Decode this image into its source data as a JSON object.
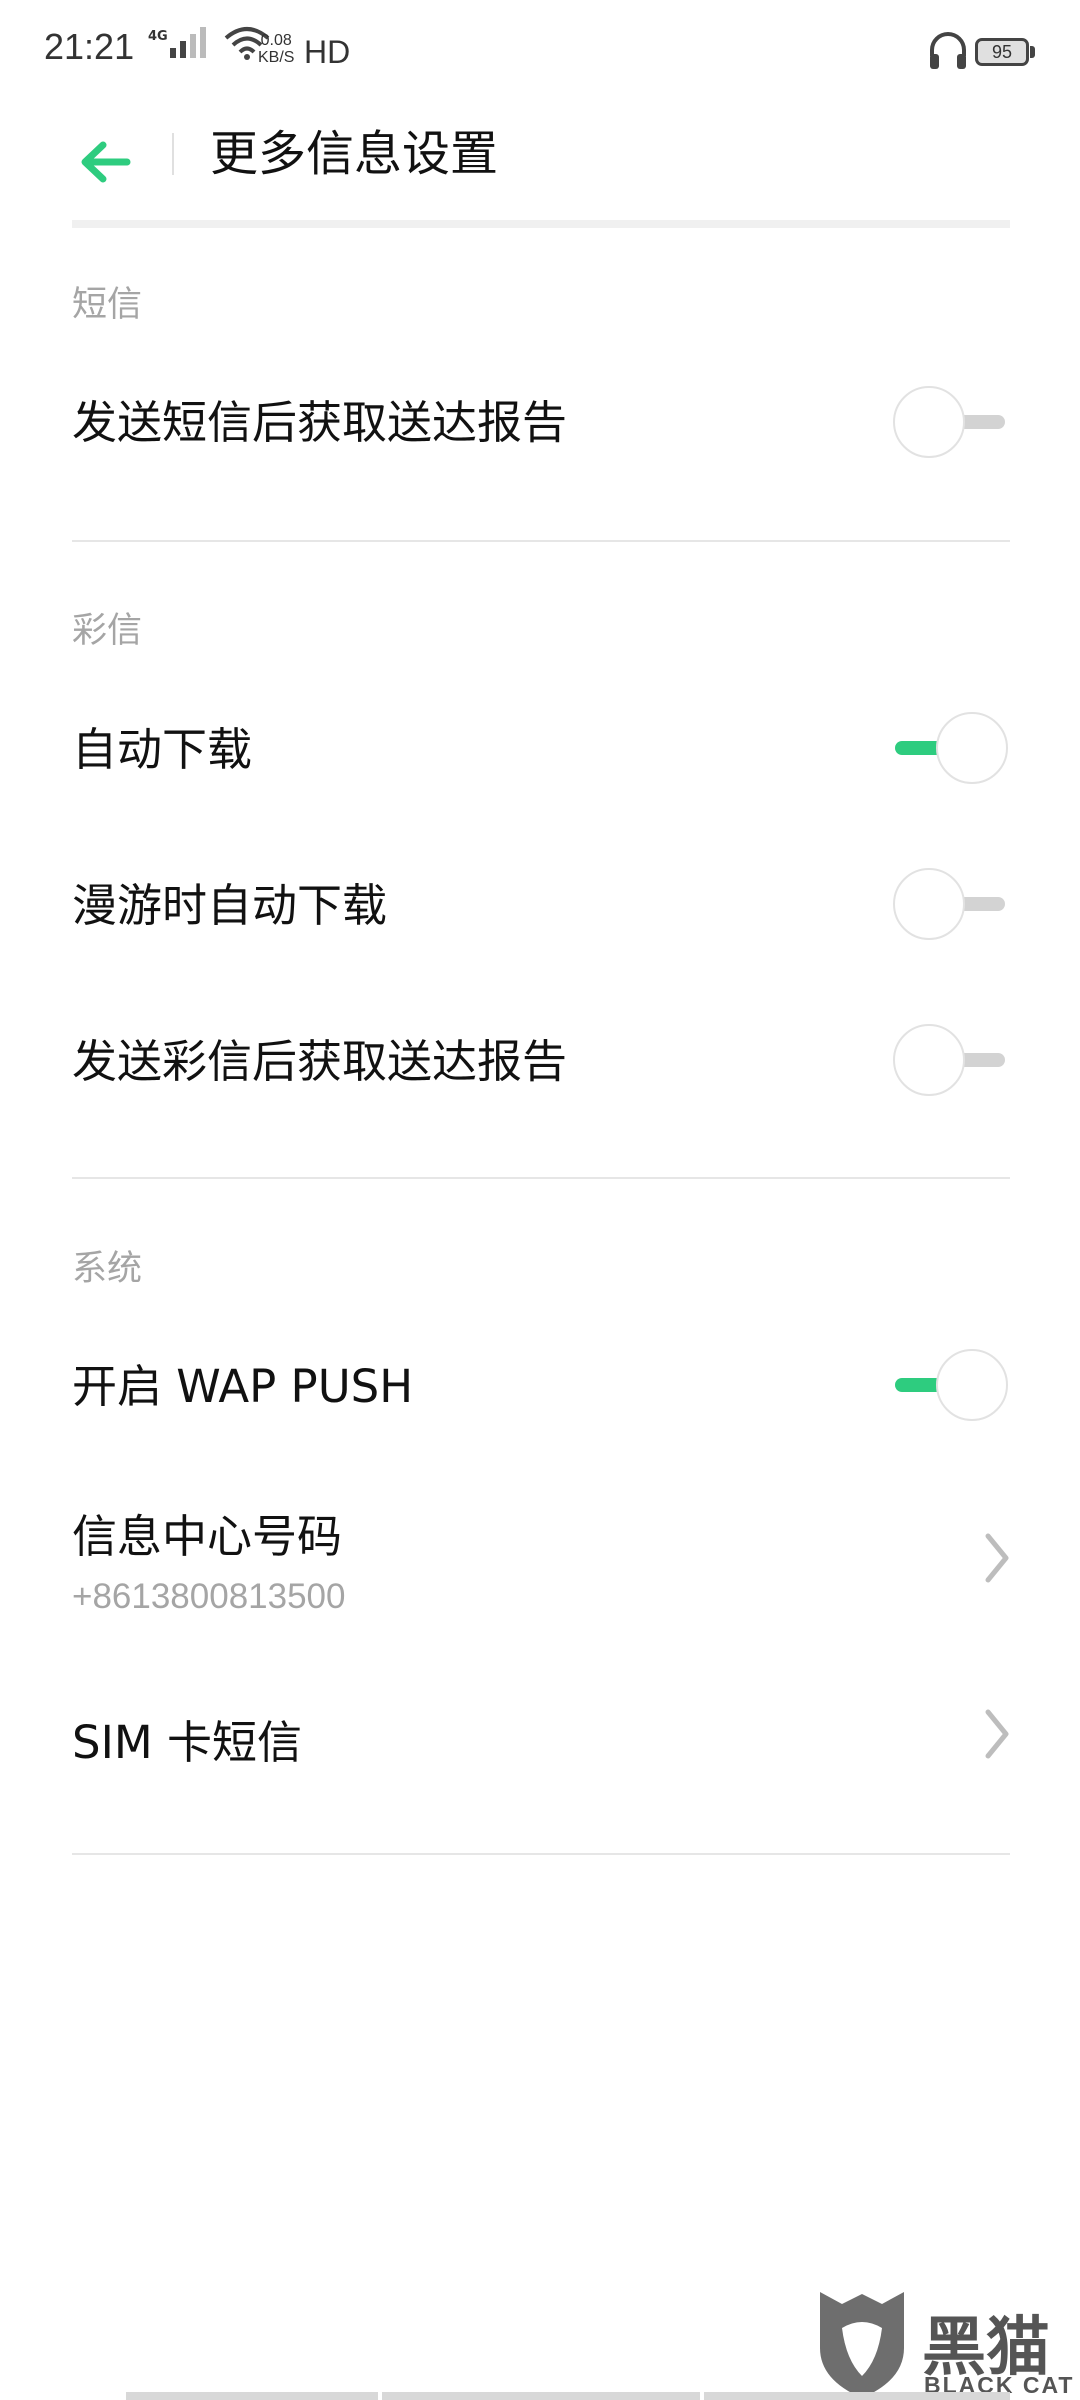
{
  "status_bar": {
    "time": "21:21",
    "network_type": "4G",
    "speed_value": "0.08",
    "speed_unit": "KB/S",
    "hd_label": "HD",
    "battery_level": "95"
  },
  "header": {
    "title": "更多信息设置"
  },
  "sections": {
    "sms": {
      "header": "短信",
      "items": [
        {
          "label": "发送短信后获取送达报告",
          "enabled": false
        }
      ]
    },
    "mms": {
      "header": "彩信",
      "items": [
        {
          "label": "自动下载",
          "enabled": true
        },
        {
          "label": "漫游时自动下载",
          "enabled": false
        },
        {
          "label": "发送彩信后获取送达报告",
          "enabled": false
        }
      ]
    },
    "system": {
      "header": "系统",
      "items": [
        {
          "label": "开启 WAP PUSH",
          "enabled": true
        },
        {
          "label": "信息中心号码",
          "subtitle": "+8613800813500"
        },
        {
          "label": "SIM 卡短信"
        }
      ]
    }
  },
  "colors": {
    "accent": "#2ecc7f",
    "section_header": "#a5a5a5",
    "divider": "#e6e6e6"
  },
  "icons": {
    "back": "arrow-left-icon",
    "chevron": "chevron-right-icon",
    "headset": "headset-icon",
    "wifi": "wifi-icon",
    "signal": "signal-icon"
  },
  "watermark": {
    "brand_zh": "黑猫",
    "brand_en": "BLACK CAT"
  }
}
